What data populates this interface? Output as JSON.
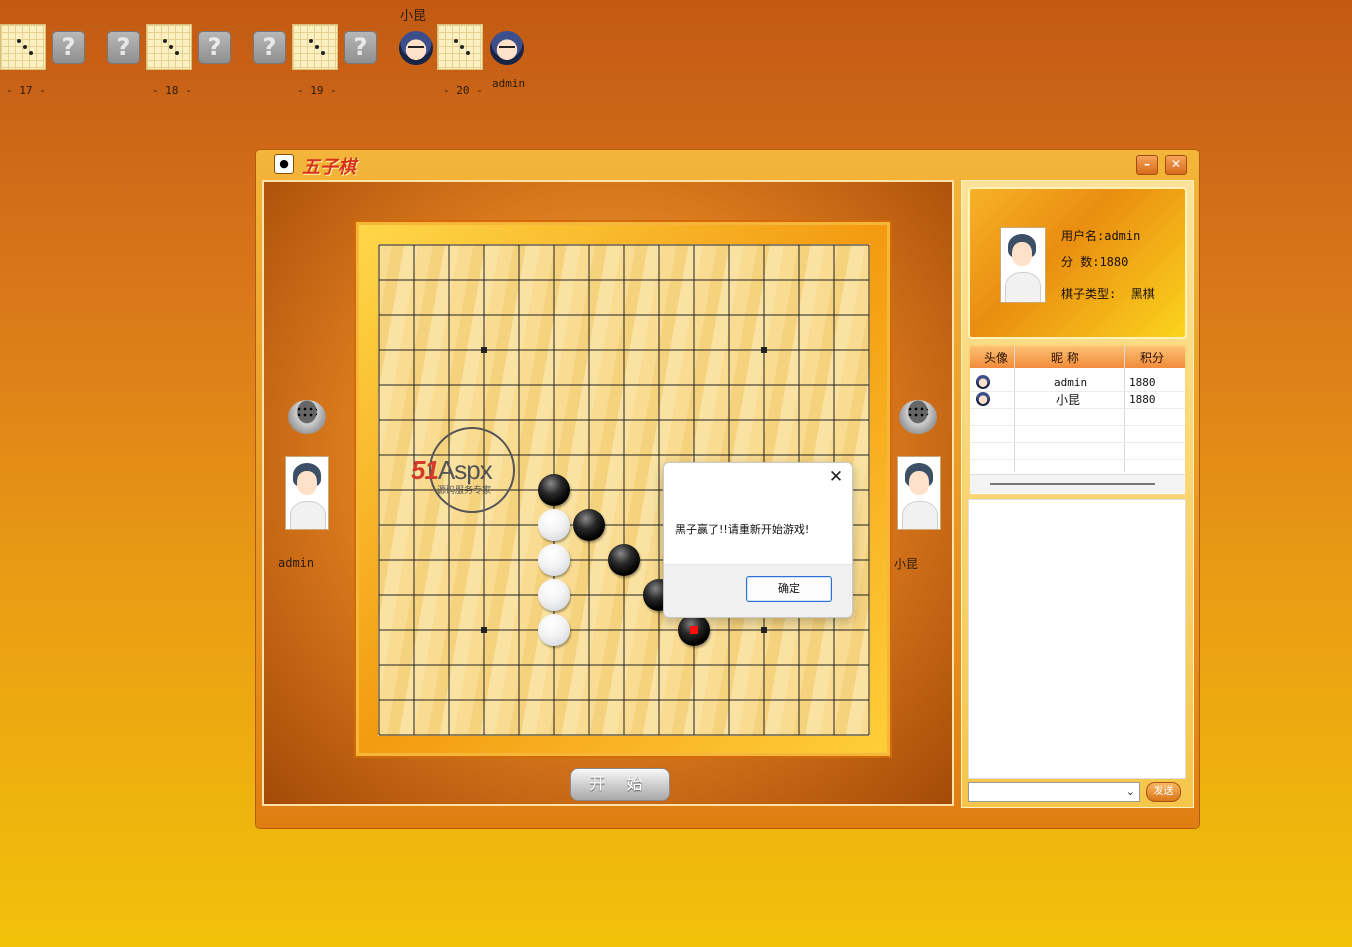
{
  "lobby": {
    "tables": [
      {
        "number": "- 17 -"
      },
      {
        "number": "- 18 -"
      },
      {
        "number": "- 19 -"
      },
      {
        "number": "- 20 -",
        "top_player": "小昆",
        "bottom_player": "admin"
      }
    ],
    "empty_seat_glyph": "?"
  },
  "window": {
    "title": "五子棋",
    "minimize_label": "–",
    "close_label": "✕"
  },
  "game": {
    "left_player": "admin",
    "right_player": "小昆",
    "start_button": "开 始",
    "watermark": {
      "brand": "51",
      "brand2": "Aspx",
      "subtitle": "源码服务专家"
    },
    "stones": [
      {
        "color": "black",
        "col": 5,
        "row": 7
      },
      {
        "color": "white",
        "col": 5,
        "row": 8
      },
      {
        "color": "black",
        "col": 6,
        "row": 8
      },
      {
        "color": "white",
        "col": 5,
        "row": 9
      },
      {
        "color": "black",
        "col": 7,
        "row": 9
      },
      {
        "color": "white",
        "col": 5,
        "row": 10
      },
      {
        "color": "black",
        "col": 8,
        "row": 10
      },
      {
        "color": "white",
        "col": 5,
        "row": 11
      },
      {
        "color": "black",
        "col": 9,
        "row": 11,
        "last": true
      }
    ]
  },
  "dialog": {
    "message": "黑子赢了!!请重新开始游戏!",
    "ok_label": "确定",
    "close_label": "✕"
  },
  "profile": {
    "username_label": "用户名:",
    "username": "admin",
    "score_label": "分  数:",
    "score": "1880",
    "piece_label": "棋子类型:",
    "piece": "黑棋"
  },
  "users": {
    "headers": [
      "头像",
      "昵 称",
      "积分"
    ],
    "rows": [
      {
        "nickname": "admin",
        "score": "1880"
      },
      {
        "nickname": "小昆",
        "score": "1880"
      }
    ]
  },
  "chat": {
    "input_value": "",
    "send_label": "发送"
  },
  "colors": {
    "accent": "#e07e12",
    "last_move": "#ff1010"
  }
}
